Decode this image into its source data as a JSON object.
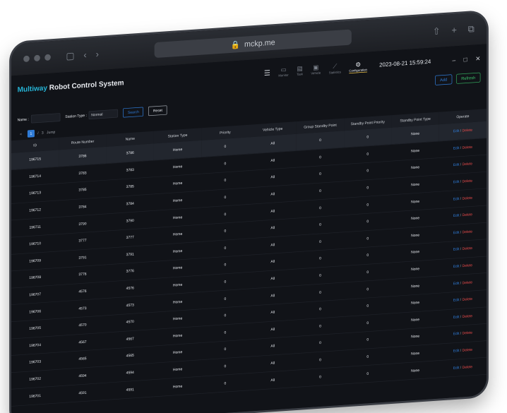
{
  "browser": {
    "url": "mckp.me"
  },
  "app": {
    "brand_accent": "Multiway",
    "brand_rest": " Robot Control System",
    "datetime": "2023-08-21 15:59:24",
    "menu": [
      {
        "label": "Monitor",
        "icon": "monitor-icon"
      },
      {
        "label": "Task",
        "icon": "task-icon"
      },
      {
        "label": "Vehicle",
        "icon": "vehicle-icon"
      },
      {
        "label": "Statistics",
        "icon": "statistics-icon"
      },
      {
        "label": "Configuration",
        "icon": "configuration-icon"
      }
    ],
    "add_label": "Add",
    "refresh_label": "Refresh"
  },
  "filters": {
    "name_label": "Name :",
    "name_value": "",
    "station_type_label": "Station Type :",
    "station_type_value": "Normal",
    "search_label": "Search",
    "reset_label": "Reset"
  },
  "pagination": {
    "prev": "<",
    "current": "1",
    "total": "3",
    "jump_label": "Jump"
  },
  "table": {
    "headers": [
      "ID",
      "Route Number",
      "Name",
      "Station Type",
      "Priority",
      "Vehicle Type",
      "Group Standby Point",
      "Standby Point Priority",
      "Standby Point Type",
      "Operate"
    ],
    "edit_label": "Edit",
    "delete_label": "Delete",
    "rows": [
      [
        "196715",
        "3786",
        "3786",
        "Home",
        "0",
        "All",
        "0",
        "0",
        "None"
      ],
      [
        "196714",
        "3783",
        "3783",
        "Home",
        "0",
        "All",
        "0",
        "0",
        "None"
      ],
      [
        "196713",
        "3785",
        "3785",
        "Home",
        "0",
        "All",
        "0",
        "0",
        "None"
      ],
      [
        "196712",
        "3784",
        "3784",
        "Home",
        "0",
        "All",
        "0",
        "0",
        "None"
      ],
      [
        "196711",
        "3790",
        "3790",
        "Home",
        "0",
        "All",
        "0",
        "0",
        "None"
      ],
      [
        "196710",
        "3777",
        "3777",
        "Home",
        "0",
        "All",
        "0",
        "0",
        "None"
      ],
      [
        "196709",
        "3791",
        "3791",
        "Home",
        "0",
        "All",
        "0",
        "0",
        "None"
      ],
      [
        "196708",
        "3776",
        "3776",
        "Home",
        "0",
        "All",
        "0",
        "0",
        "None"
      ],
      [
        "196707",
        "4576",
        "4576",
        "Home",
        "0",
        "All",
        "0",
        "0",
        "None"
      ],
      [
        "196706",
        "4573",
        "4573",
        "Home",
        "0",
        "All",
        "0",
        "0",
        "None"
      ],
      [
        "196705",
        "4570",
        "4570",
        "Home",
        "0",
        "All",
        "0",
        "0",
        "None"
      ],
      [
        "196704",
        "4567",
        "4567",
        "Home",
        "0",
        "All",
        "0",
        "0",
        "None"
      ],
      [
        "196703",
        "4565",
        "4565",
        "Home",
        "0",
        "All",
        "0",
        "0",
        "None"
      ],
      [
        "196702",
        "4594",
        "4594",
        "Home",
        "0",
        "All",
        "0",
        "0",
        "None"
      ],
      [
        "196701",
        "4591",
        "4591",
        "Home",
        "0",
        "All",
        "0",
        "0",
        "None"
      ]
    ]
  },
  "colors": {
    "accent": "#25b4d6",
    "primary": "#2f7bd6",
    "success": "#3cc46c",
    "danger": "#e04848",
    "highlight": "#f3c84c"
  }
}
